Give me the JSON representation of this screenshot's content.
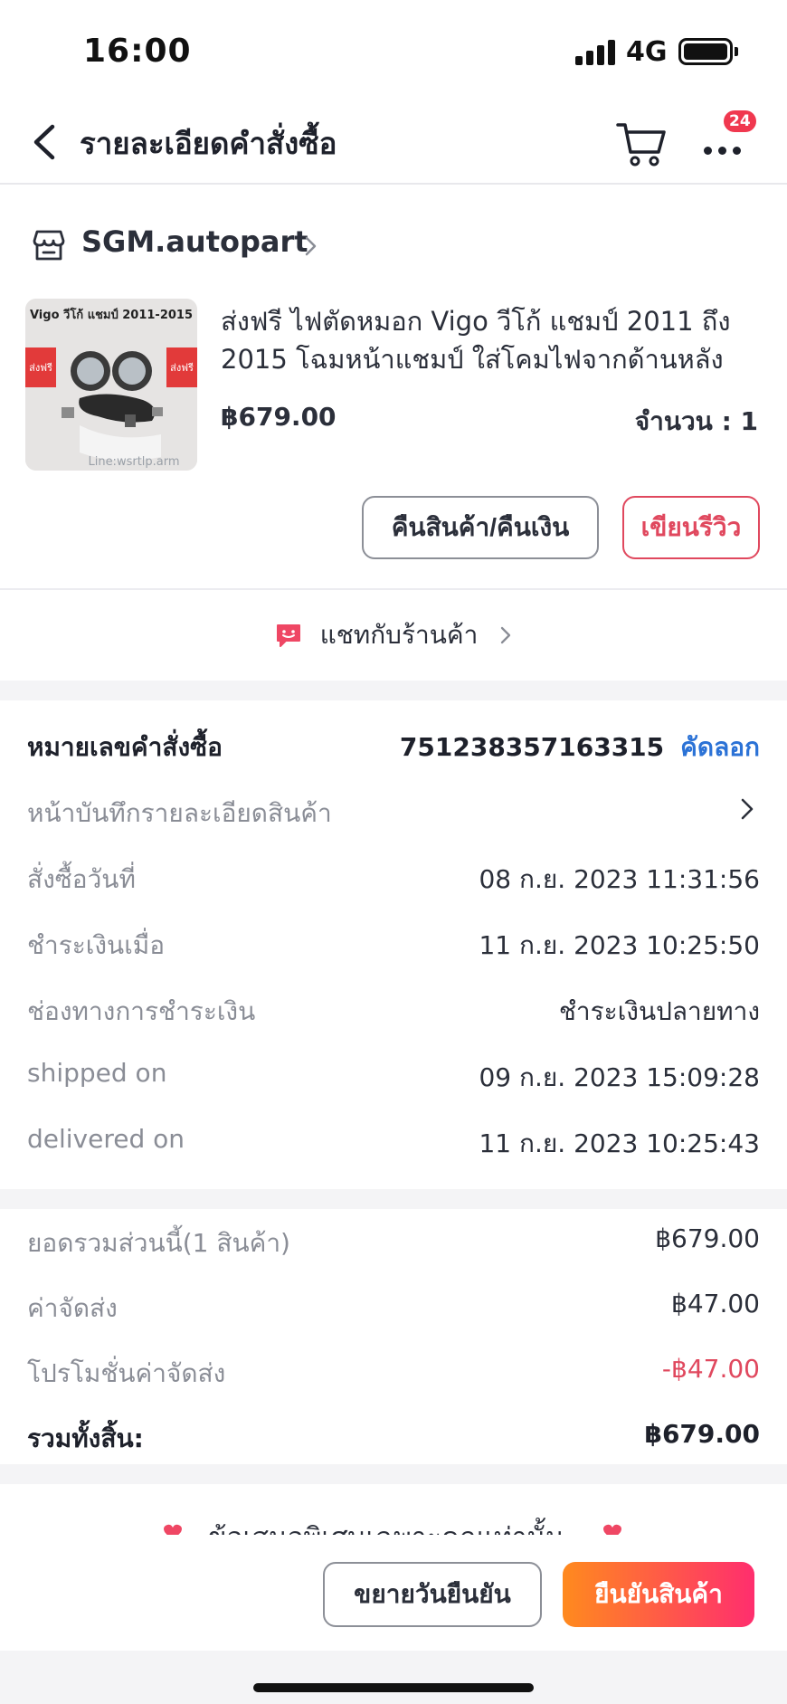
{
  "status_bar": {
    "time": "16:00",
    "network": "4G",
    "battery_level": 1.0
  },
  "header": {
    "title": "รายละเอียดคำสั่งซื้อ",
    "back_icon": "chevron-left-icon",
    "cart_icon": "cart-icon",
    "more_icon": "more-dots-icon",
    "notification_badge": "24"
  },
  "store": {
    "name": "SGM.autopart"
  },
  "product": {
    "image_caption": "Vigo วีโก้ แชมป์ 2011-2015",
    "image_tag_left": "ส่งฟรี",
    "image_tag_right": "ส่งฟรี",
    "image_watermark": "Line:wsrtlp.arm",
    "title": "ส่งฟรี ไฟตัดหมอก Vigo วีโก้ แชมป์ 2011 ถึง 2015 โฉมหน้าแชมป์ ใส่โคมไฟจากด้านหลังกัน…",
    "price": "฿679.00",
    "quantity": "จำนวน : 1"
  },
  "actions": {
    "return_label": "คืนสินค้า/คืนเงิน",
    "review_label": "เขียนรีวิว"
  },
  "chat": {
    "label": "แชทกับร้านค้า"
  },
  "order_info": {
    "order_no_label": "หมายเลขคำสั่งซื้อ",
    "order_no": "751238357163315",
    "copy_label": "คัดลอก",
    "snapshot_label": "หน้าบันทึกรายละเอียดสินค้า",
    "rows": [
      {
        "label": "สั่งซื้อวันที่",
        "value": "08 ก.ย. 2023  11:31:56"
      },
      {
        "label": "ชำระเงินเมื่อ",
        "value": "11 ก.ย. 2023  10:25:50"
      },
      {
        "label": "ช่องทางการชำระเงิน",
        "value": "ชำระเงินปลายทาง"
      },
      {
        "label": "shipped on",
        "value": "09 ก.ย. 2023  15:09:28"
      },
      {
        "label": "delivered on",
        "value": "11 ก.ย. 2023  10:25:43"
      }
    ]
  },
  "summary": {
    "subtotal_label": "ยอดรวมส่วนนี้(1 สินค้า)",
    "subtotal": "฿679.00",
    "shipping_label": "ค่าจัดส่ง",
    "shipping": "฿47.00",
    "shipping_promo_label": "โปรโมชั่นค่าจัดส่ง",
    "shipping_promo": "-฿47.00",
    "total_label": "รวมทั้งสิ้น:",
    "total": "฿679.00"
  },
  "promo_banner": {
    "text": "ข้อเสนอพิเศษเฉพาะคุณเท่านั้น"
  },
  "bottom_actions": {
    "extend_label": "ขยายวันยืนยัน",
    "confirm_label": "ยืนยันสินค้า"
  },
  "colors": {
    "accent_red": "#e0485e",
    "link_blue": "#2b72d6",
    "confirm_gradient_start": "#ff8a1e",
    "confirm_gradient_end": "#ff2e6e"
  }
}
